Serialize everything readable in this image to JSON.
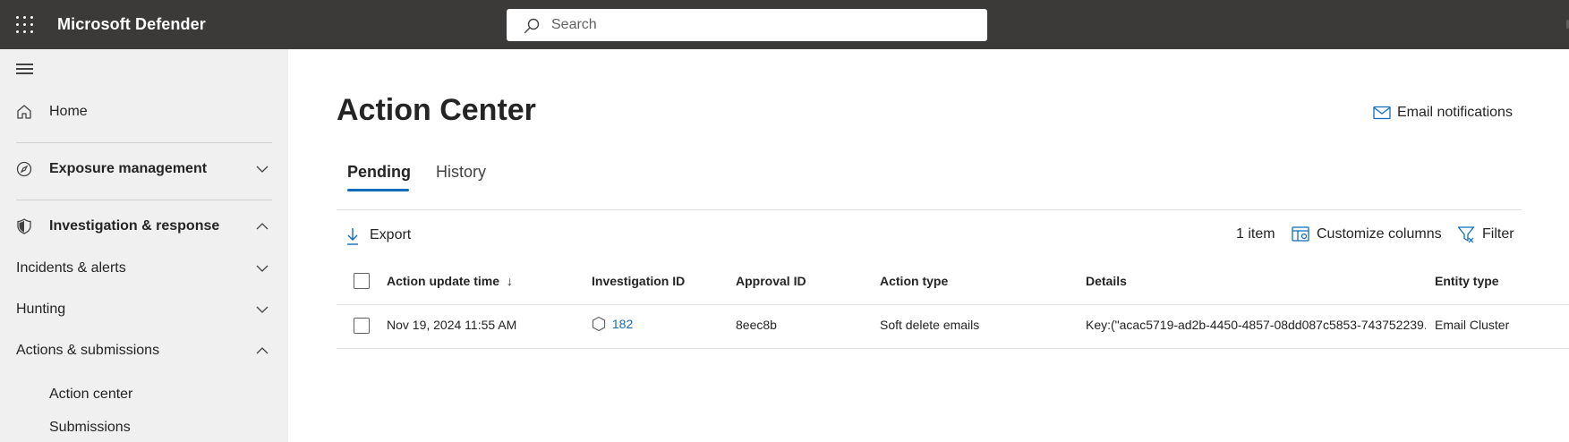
{
  "topbar": {
    "app_title": "Microsoft Defender",
    "search_placeholder": "Search",
    "background": "#3b3a39"
  },
  "sidebar": {
    "items": [
      {
        "label": "Home",
        "icon": "home-icon"
      },
      {
        "label": "Exposure management",
        "icon": "exposure-icon",
        "expanded": false
      },
      {
        "label": "Investigation & response",
        "icon": "shield-icon",
        "expanded": true
      },
      {
        "label": "Incidents & alerts",
        "expanded": false
      },
      {
        "label": "Hunting",
        "expanded": false
      },
      {
        "label": "Actions & submissions",
        "expanded": true
      },
      {
        "label": "Action center"
      },
      {
        "label": "Submissions"
      }
    ]
  },
  "main": {
    "title": "Action Center",
    "email_notifications": "Email notifications",
    "tabs": [
      {
        "label": "Pending",
        "active": true
      },
      {
        "label": "History",
        "active": false
      }
    ],
    "toolbar": {
      "export": "Export",
      "item_count": "1 item",
      "customize_columns": "Customize columns",
      "filter": "Filter"
    },
    "table": {
      "columns": [
        "Action update time",
        "Investigation ID",
        "Approval ID",
        "Action type",
        "Details",
        "Entity type"
      ],
      "sort_indicator": "↓",
      "rows": [
        {
          "action_update_time": "Nov 19, 2024 11:55 AM",
          "investigation_id": "182",
          "approval_id": "8eec8b",
          "action_type": "Soft delete emails",
          "details": "Key:(\"acac5719-ad2b-4450-4857-08dd087c5853-743752239...",
          "entity_type": "Email Cluster"
        }
      ]
    }
  },
  "colors": {
    "accent": "#0f6cbd",
    "sidebar_bg": "#f0f0f0"
  }
}
